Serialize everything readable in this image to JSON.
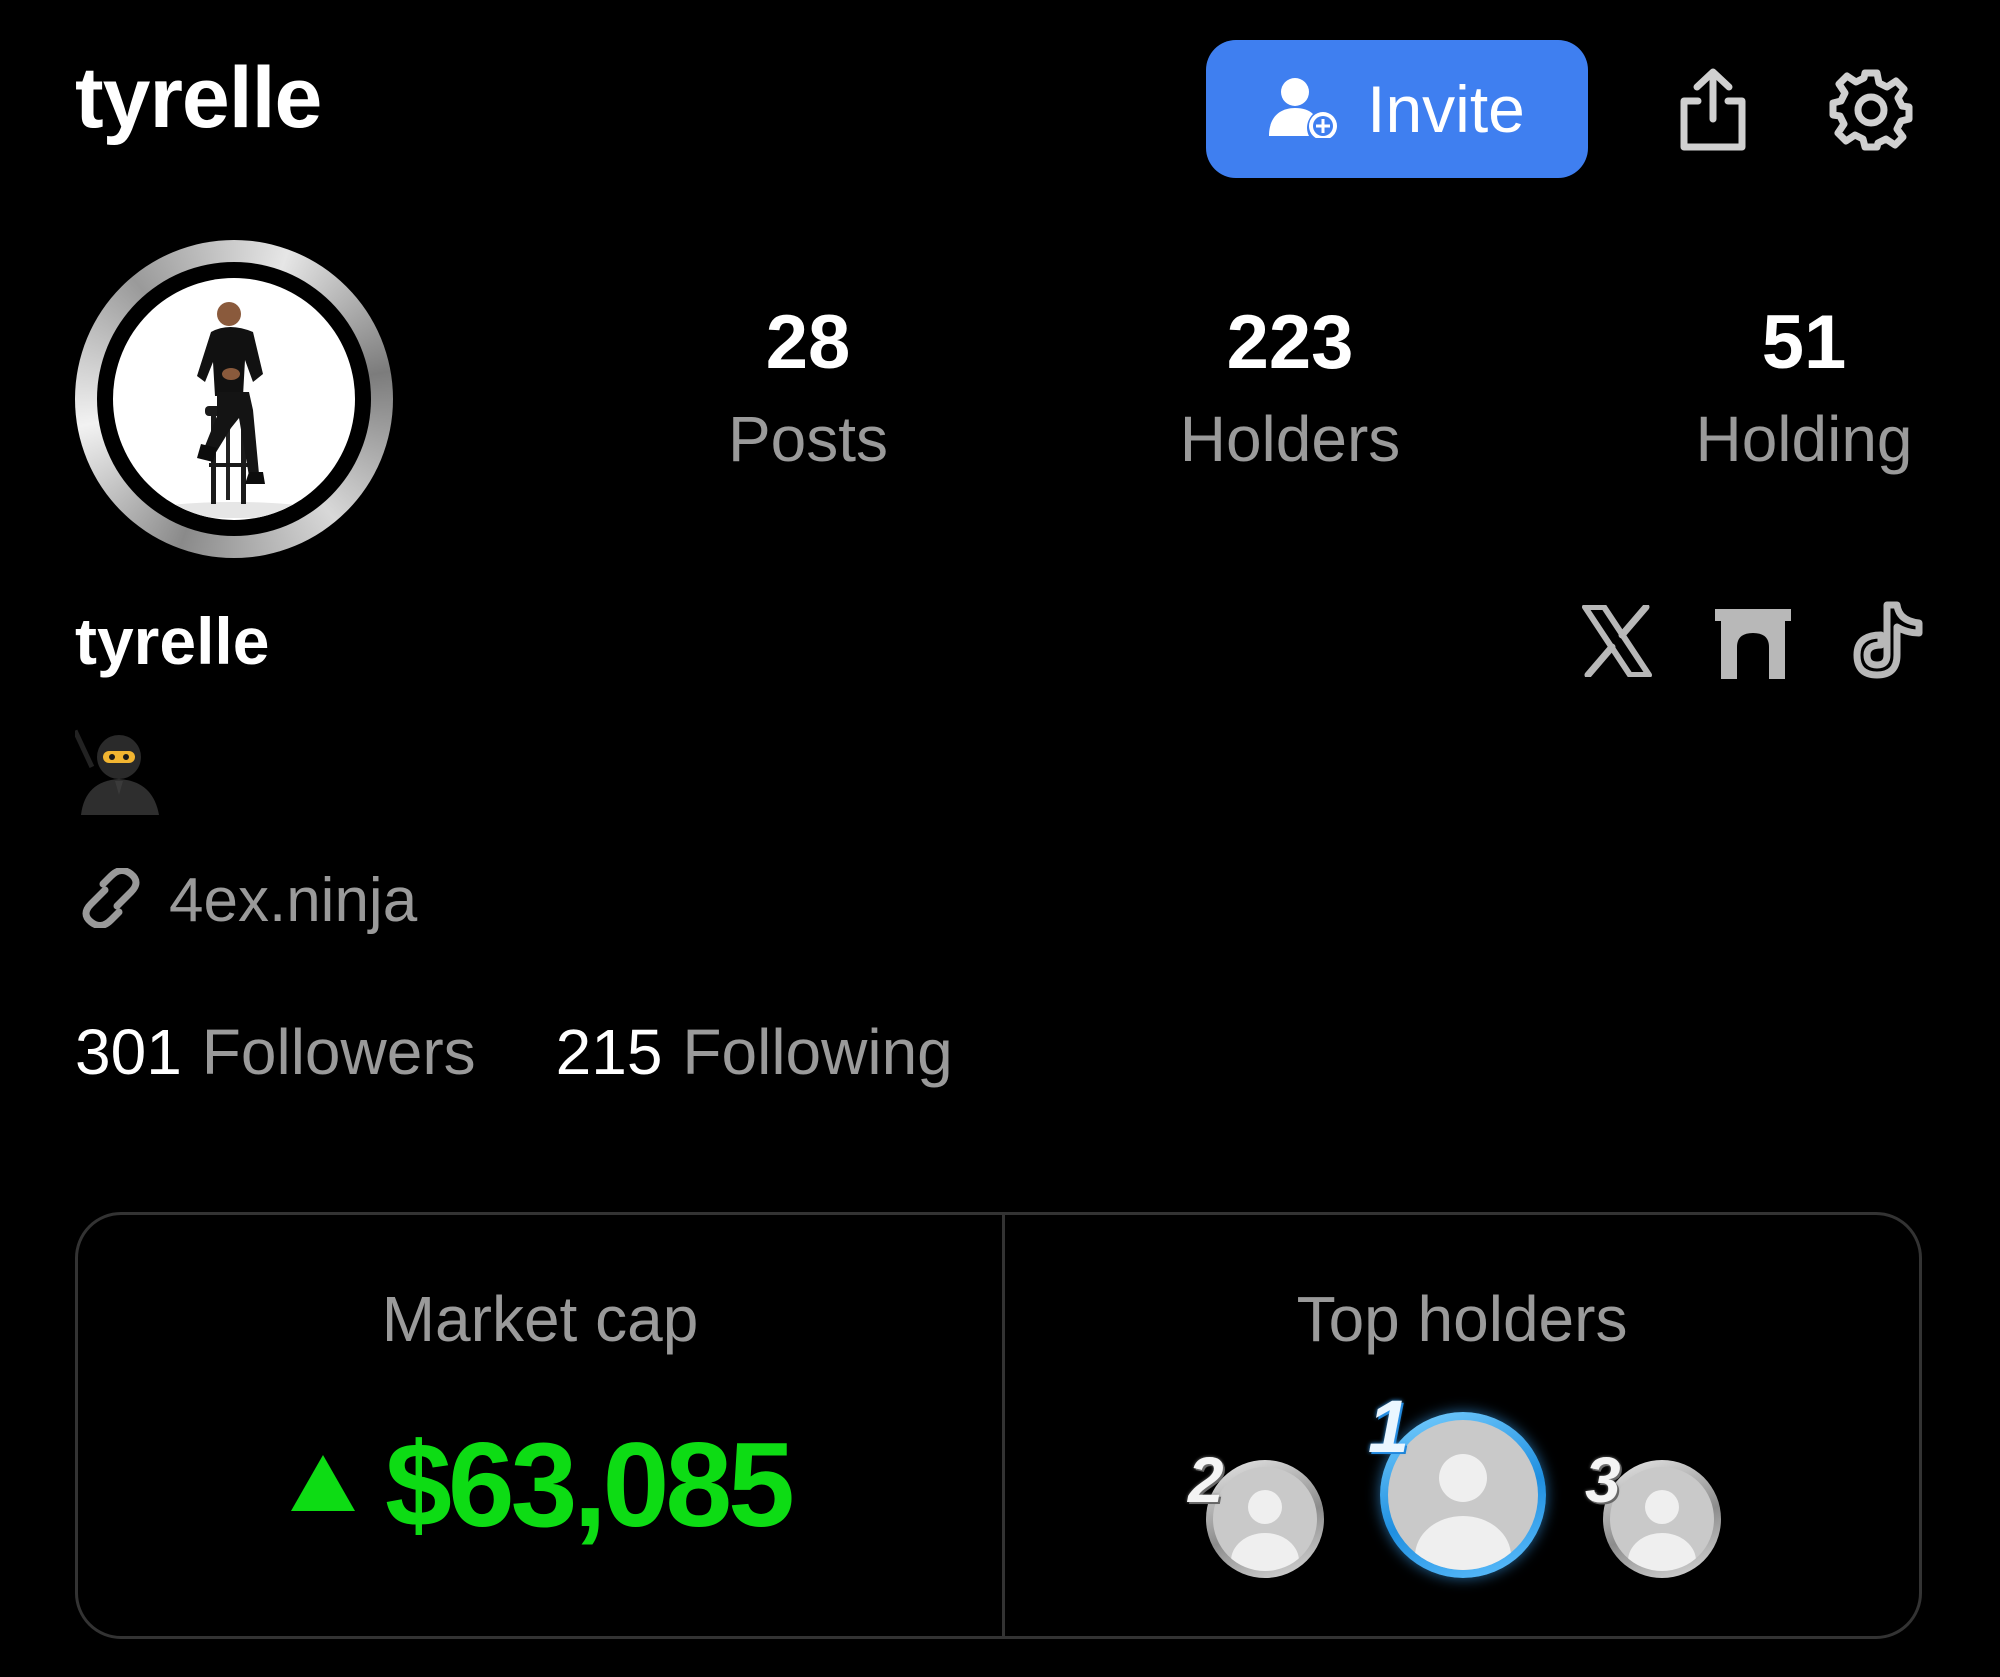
{
  "header": {
    "username": "tyrelle",
    "invite_label": "Invite"
  },
  "stats": [
    {
      "value": "28",
      "label": "Posts"
    },
    {
      "value": "223",
      "label": "Holders"
    },
    {
      "value": "51",
      "label": "Holding"
    }
  ],
  "profile": {
    "display_name": "tyrelle",
    "bio_emoji": "ninja",
    "link": "4ex.ninja",
    "socials": [
      "x-icon",
      "arch-icon",
      "tiktok-icon"
    ]
  },
  "follow": {
    "followers_count": "301",
    "followers_label": "Followers",
    "following_count": "215",
    "following_label": "Following"
  },
  "market_cap": {
    "label": "Market cap",
    "value": "$63,085",
    "trend": "up",
    "color": "#0ddc14"
  },
  "top_holders": {
    "label": "Top holders",
    "ranks": [
      "2",
      "1",
      "3"
    ]
  },
  "colors": {
    "accent": "#3f7ff0",
    "muted": "#9a9a9a",
    "positive": "#0ddc14"
  }
}
